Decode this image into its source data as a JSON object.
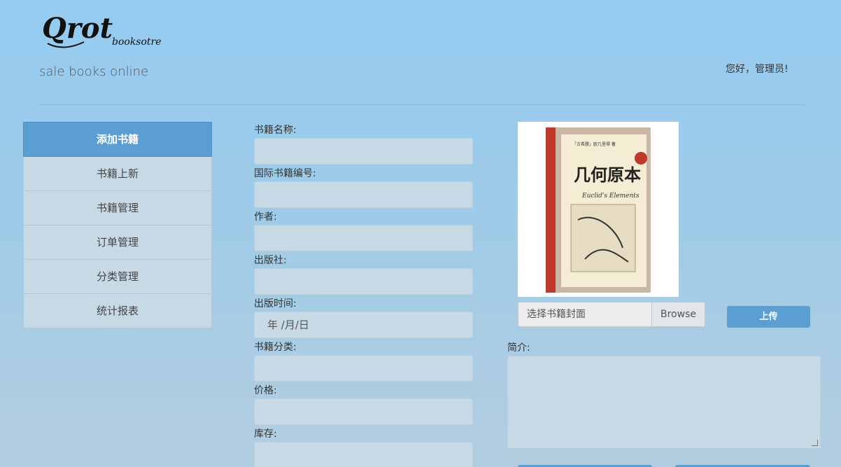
{
  "header": {
    "logo_main": "Qrot",
    "logo_sub": "booksotre",
    "tagline": "sale books online",
    "greeting": "您好，管理员!"
  },
  "sidebar": {
    "items": [
      {
        "label": "添加书籍",
        "active": true
      },
      {
        "label": "书籍上新"
      },
      {
        "label": "书籍管理"
      },
      {
        "label": "订单管理"
      },
      {
        "label": "分类管理"
      },
      {
        "label": "统计报表"
      }
    ]
  },
  "form": {
    "name_label": "书籍名称:",
    "isbn_label": "国际书籍编号:",
    "author_label": "作者:",
    "publisher_label": "出版社:",
    "pubdate_label": "出版时间:",
    "pubdate_value": "年 /月/日",
    "category_label": "书籍分类:",
    "price_label": "价格:",
    "stock_label": "库存:"
  },
  "cover": {
    "series": "「古希腊」欧几里得 著",
    "title": "几何原本",
    "english": "Euclid's Elements",
    "file_placeholder": "选择书籍封面",
    "browse_label": "Browse",
    "upload_label": "上传"
  },
  "intro": {
    "label": "简介:"
  },
  "colors": {
    "accent": "#5b9fd2",
    "input_bg": "#c8d9e6"
  }
}
